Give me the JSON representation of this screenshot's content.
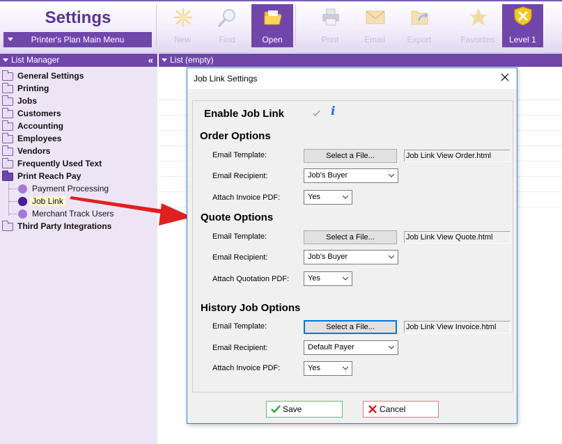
{
  "app": {
    "title": "Settings",
    "main_menu_label": "Printer's Plan Main Menu"
  },
  "ribbon": {
    "buttons": [
      {
        "id": "new",
        "label": "New",
        "icon": "sparkle-icon",
        "enabled": false
      },
      {
        "id": "find",
        "label": "Find",
        "icon": "magnifier-icon",
        "enabled": false
      },
      {
        "id": "open",
        "label": "Open",
        "icon": "folder-open-icon",
        "enabled": true,
        "active": true
      },
      {
        "id": "print",
        "label": "Print",
        "icon": "printer-icon",
        "enabled": false
      },
      {
        "id": "email",
        "label": "Email",
        "icon": "envelope-icon",
        "enabled": false
      },
      {
        "id": "export",
        "label": "Export",
        "icon": "export-folder-icon",
        "enabled": false
      },
      {
        "id": "favorites",
        "label": "Favorites",
        "icon": "star-icon",
        "enabled": false
      }
    ],
    "level_label": "Level 1",
    "level_icon": "shield-badge-icon"
  },
  "list_manager": {
    "title": "List Manager",
    "items": [
      {
        "label": "General Settings",
        "type": "folder"
      },
      {
        "label": "Printing",
        "type": "folder"
      },
      {
        "label": "Jobs",
        "type": "folder"
      },
      {
        "label": "Customers",
        "type": "folder"
      },
      {
        "label": "Accounting",
        "type": "folder"
      },
      {
        "label": "Employees",
        "type": "folder"
      },
      {
        "label": "Vendors",
        "type": "folder"
      },
      {
        "label": "Frequently Used Text",
        "type": "folder"
      },
      {
        "label": "Print Reach Pay",
        "type": "folder-open"
      },
      {
        "label": "Payment Processing",
        "type": "child"
      },
      {
        "label": "Job Link",
        "type": "child",
        "selected": true
      },
      {
        "label": "Merchant Track Users",
        "type": "child"
      },
      {
        "label": "Third Party Integrations",
        "type": "folder"
      }
    ]
  },
  "list_panel": {
    "title": "List (empty)"
  },
  "dialog": {
    "title": "Job Link Settings",
    "enable_label": "Enable Job Link",
    "enable_checked": true,
    "sections": {
      "order": {
        "title": "Order Options",
        "template_label": "Email Template:",
        "template_button": "Select a File...",
        "template_path": "Job Link View Order.html",
        "recipient_label": "Email Recipient:",
        "recipient_value": "Job's Buyer",
        "attach_label": "Attach Invoice PDF:",
        "attach_value": "Yes"
      },
      "quote": {
        "title": "Quote Options",
        "template_label": "Email Template:",
        "template_button": "Select a File...",
        "template_path": "Job Link View Quote.html",
        "recipient_label": "Email Recipient:",
        "recipient_value": "Job's Buyer",
        "attach_label": "Attach Quotation PDF:",
        "attach_value": "Yes"
      },
      "history": {
        "title": "History Job Options",
        "template_label": "Email Template:",
        "template_button": "Select a File...",
        "template_path": "Job Link View Invoice.html",
        "recipient_label": "Email Recipient:",
        "recipient_value": "Default Payer",
        "attach_label": "Attach Invoice PDF:",
        "attach_value": "Yes"
      }
    },
    "save_label": "Save",
    "cancel_label": "Cancel"
  },
  "colors": {
    "accent_purple": "#7046ab",
    "title_purple": "#5a3294",
    "sidebar_bg": "#ede5f6",
    "selection_highlight": "#fcf8c9",
    "arrow_red": "#e02020",
    "save_green": "#2ea043",
    "cancel_red": "#d81b1b",
    "info_blue": "#2a6bd1"
  }
}
